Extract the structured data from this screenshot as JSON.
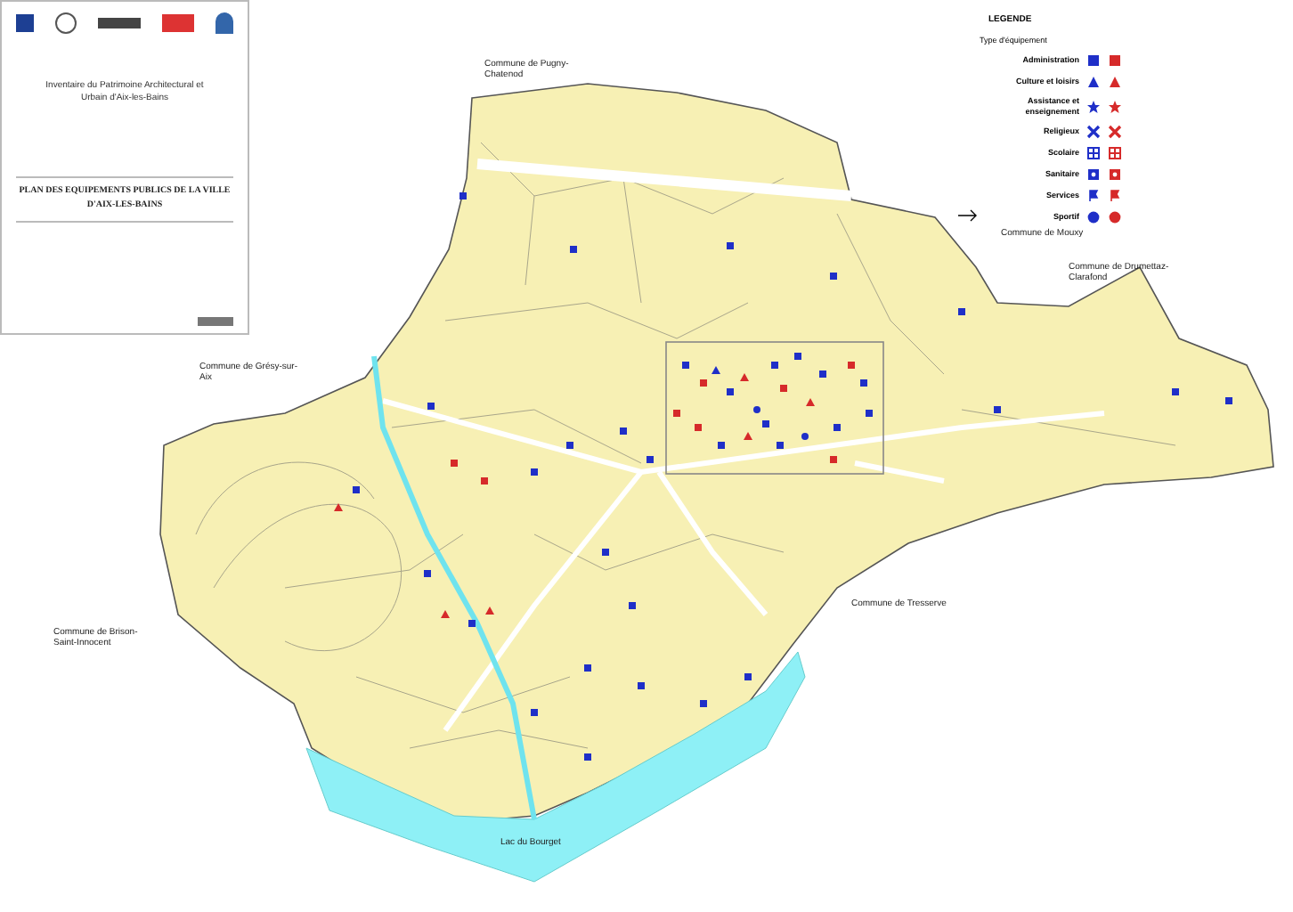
{
  "title_card": {
    "subtitle": "Inventaire du Patrimoine Architectural et Urbain d'Aix-les-Bains",
    "title": "PLAN DES EQUIPEMENTS PUBLICS DE LA VILLE D'AIX-LES-BAINS"
  },
  "legend": {
    "heading": "LEGENDE",
    "type_label": "Type d'équipement",
    "columns": [
      {
        "color": "#1f2fc8"
      },
      {
        "color": "#d62a2a"
      }
    ],
    "rows": [
      {
        "label": "Administration",
        "kind": "square"
      },
      {
        "label": "Culture et loisirs",
        "kind": "triangle"
      },
      {
        "label": "Assistance et enseignement",
        "kind": "star"
      },
      {
        "label": "Religieux",
        "kind": "cross"
      },
      {
        "label": "Scolaire",
        "kind": "grid"
      },
      {
        "label": "Sanitaire",
        "kind": "dotsquare"
      },
      {
        "label": "Services",
        "kind": "flag"
      },
      {
        "label": "Sportif",
        "kind": "circle"
      }
    ]
  },
  "places": [
    {
      "label": "Commune de Pugny-Chatenod"
    },
    {
      "label": "Commune de Mouxy"
    },
    {
      "label": "Commune de Drumettaz-Clarafond"
    },
    {
      "label": "Commune de Grésy-sur-Aix"
    },
    {
      "label": "Commune de Brison-Saint-Innocent"
    },
    {
      "label": "Commune de Tresserve"
    },
    {
      "label": "Lac du Bourget"
    }
  ]
}
